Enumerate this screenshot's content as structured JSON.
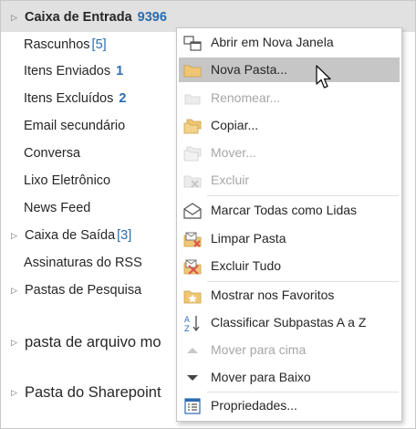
{
  "folders": {
    "inbox": {
      "label": "Caixa de Entrada",
      "count": "9396"
    },
    "drafts": {
      "label": "Rascunhos",
      "count": "[5]"
    },
    "sent": {
      "label": "Itens Enviados",
      "count": "1"
    },
    "deleted": {
      "label": "Itens Excluídos",
      "count": "2"
    },
    "secondary_email": {
      "label": "Email secundário"
    },
    "conversation": {
      "label": "Conversa"
    },
    "junk": {
      "label": "Lixo Eletrônico"
    },
    "news_feed": {
      "label": "News Feed"
    },
    "outbox": {
      "label": "Caixa de Saída",
      "count": "[3]"
    },
    "rss": {
      "label": "Assinaturas do RSS"
    },
    "search": {
      "label": "Pastas de Pesquisa"
    },
    "archive": {
      "label": "pasta de arquivo mo"
    },
    "sharepoint": {
      "label": "Pasta do Sharepoint"
    }
  },
  "menu": {
    "open_new_window": "Abrir em Nova Janela",
    "new_folder": "Nova Pasta...",
    "rename": "Renomear...",
    "copy": "Copiar...",
    "move": "Mover...",
    "delete": "Excluir",
    "mark_all_read": "Marcar Todas como Lidas",
    "clean_folder": "Limpar Pasta",
    "delete_all": "Excluir Tudo",
    "show_favorites": "Mostrar nos Favoritos",
    "sort_subfolders": "Classificar Subpastas A a  Z",
    "move_up": "Mover para cima",
    "move_down": "Mover para Baixo",
    "properties": "Propriedades..."
  },
  "colors": {
    "accent": "#2b6cb0",
    "highlight": "#c6c6c6",
    "folder_icon": "#f0c674",
    "disabled_text": "#a6a6a6"
  }
}
